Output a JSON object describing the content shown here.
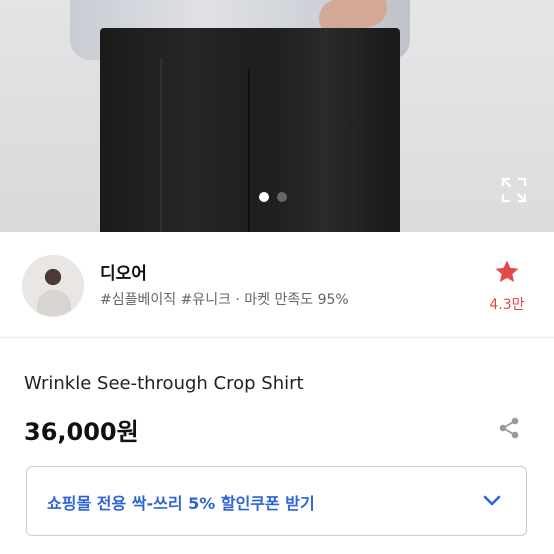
{
  "gallery": {
    "expand_icon": "expand-icon",
    "active_index": 0,
    "total": 2
  },
  "seller": {
    "name": "디오어",
    "meta": "#심플베이직 #유니크 · 마켓 만족도 95%",
    "favorite_count": "4.3만",
    "favorite_icon": "star-icon",
    "favorite_color": "#e04a4a"
  },
  "product": {
    "name": "Wrinkle See-through Crop Shirt",
    "price": "36,000원",
    "share_icon": "share-icon"
  },
  "coupon": {
    "label": "쇼핑몰 전용 싹-쓰리 5% 할인쿠폰 받기",
    "label_color": "#2f63d8",
    "chevron_icon": "chevron-down-icon"
  }
}
